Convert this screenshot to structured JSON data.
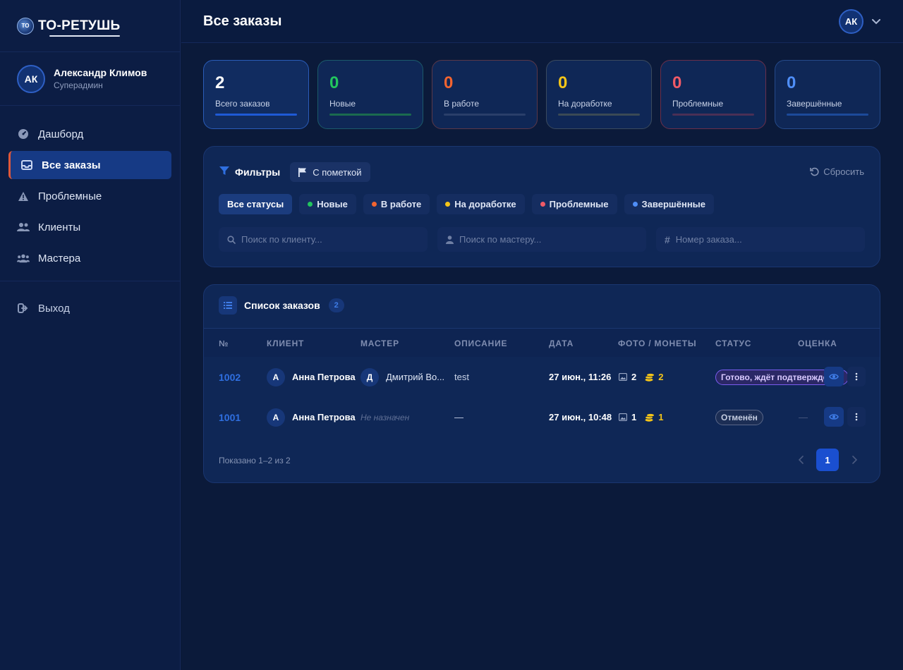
{
  "brand": {
    "name": "ТО-РЕТУШЬ",
    "badge": "TO"
  },
  "user": {
    "initials": "АК",
    "name": "Александр Климов",
    "role": "Суперадмин"
  },
  "nav": {
    "items": [
      {
        "label": "Дашборд",
        "icon": "dashboard-icon"
      },
      {
        "label": "Все заказы",
        "icon": "inbox-icon",
        "active": true
      },
      {
        "label": "Проблемные",
        "icon": "warning-icon"
      },
      {
        "label": "Клиенты",
        "icon": "users-icon"
      },
      {
        "label": "Мастера",
        "icon": "team-icon"
      }
    ],
    "logout": "Выход"
  },
  "header": {
    "title": "Все заказы",
    "avatar": "АК"
  },
  "stats": [
    {
      "value": "2",
      "label": "Всего заказов",
      "color": "#ffffff",
      "bar": "#1f5ad6",
      "fill": 1.0
    },
    {
      "value": "0",
      "label": "Новые",
      "color": "#22c55e",
      "bar": "#1b6b4f",
      "fill": 1.0
    },
    {
      "value": "0",
      "label": "В работе",
      "color": "#f26430",
      "bar": "#3a4468",
      "fill": 0.0
    },
    {
      "value": "0",
      "label": "На доработке",
      "color": "#f5c518",
      "bar": "#3b4a55",
      "fill": 1.0
    },
    {
      "value": "0",
      "label": "Проблемные",
      "color": "#f05a67",
      "bar": "#4a2f55",
      "fill": 1.0
    },
    {
      "value": "0",
      "label": "Завершённые",
      "color": "#4f8ef7",
      "bar": "#1c4a9a",
      "fill": 1.0
    }
  ],
  "filters": {
    "title": "Фильтры",
    "flagged": "С пометкой",
    "reset": "Сбросить",
    "chips": [
      {
        "label": "Все статусы",
        "dot": "",
        "active": true
      },
      {
        "label": "Новые",
        "dot": "#22c55e"
      },
      {
        "label": "В работе",
        "dot": "#f26430"
      },
      {
        "label": "На доработке",
        "dot": "#f5c518"
      },
      {
        "label": "Проблемные",
        "dot": "#f05a67"
      },
      {
        "label": "Завершённые",
        "dot": "#4f8ef7"
      }
    ],
    "search_client": "Поиск по клиенту...",
    "search_master": "Поиск по мастеру...",
    "search_order": "Номер заказа..."
  },
  "orders": {
    "title": "Список заказов",
    "count": "2",
    "columns": [
      "№",
      "КЛИЕНТ",
      "МАСТЕР",
      "ОПИСАНИЕ",
      "ДАТА",
      "ФОТО / МОНЕТЫ",
      "СТАТУС",
      "ОЦЕНКА"
    ],
    "rows": [
      {
        "number": "1002",
        "client_initial": "А",
        "client": "Анна Петрова",
        "master_initial": "Д",
        "master": "Дмитрий Во...",
        "description": "test",
        "date": "27 июн., 11:26",
        "photos": "2",
        "coins": "2",
        "status": "Готово, ждёт подтверждения",
        "rating": ""
      },
      {
        "number": "1001",
        "client_initial": "А",
        "client": "Анна Петрова",
        "master_initial": "",
        "master": "Не назначен",
        "description": "—",
        "date": "27 июн., 10:48",
        "photos": "1",
        "coins": "1",
        "status": "Отменён",
        "rating": "—"
      }
    ],
    "shown": "Показано 1–2 из 2",
    "page": "1"
  }
}
